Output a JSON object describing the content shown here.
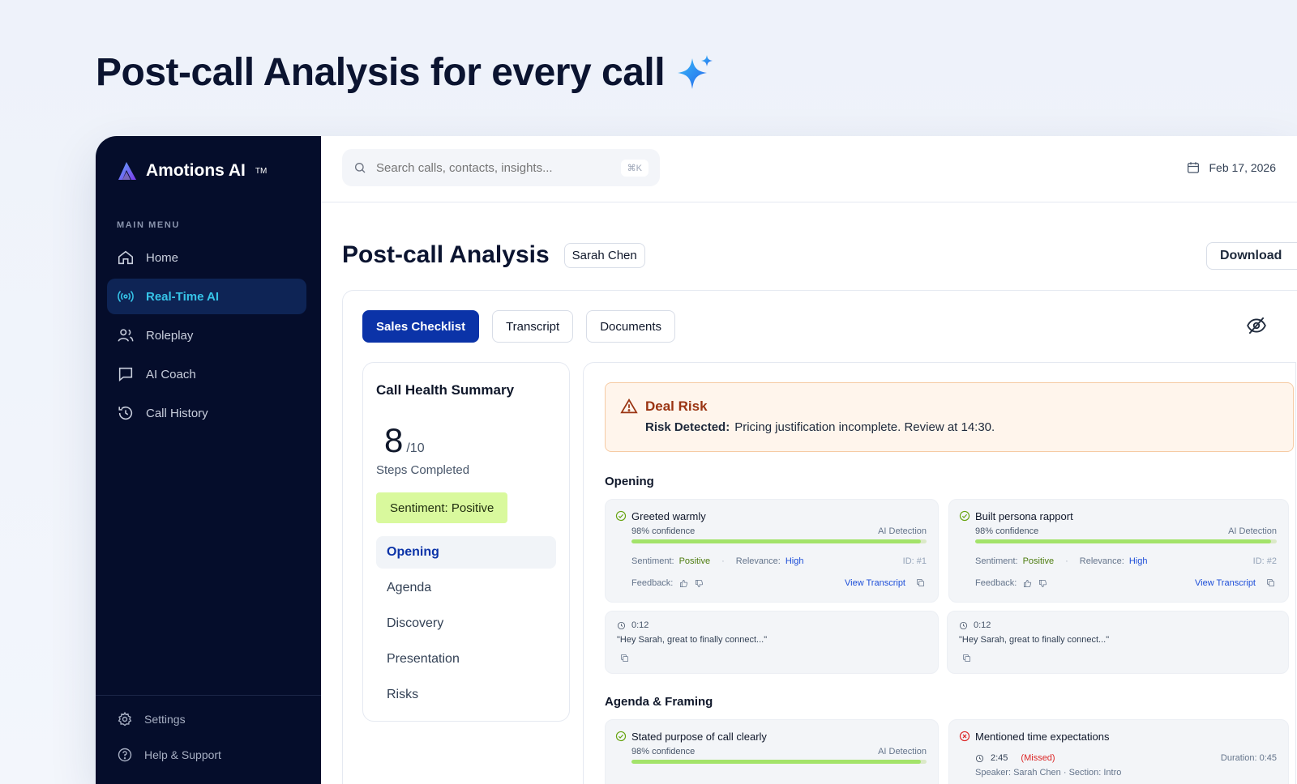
{
  "hero": {
    "title": "Post-call Analysis for every call"
  },
  "brand": {
    "name": "Amotions AI",
    "tm": "TM"
  },
  "sidebar": {
    "menu_label": "MAIN MENU",
    "items": [
      {
        "label": "Home",
        "icon": "home-icon"
      },
      {
        "label": "Real-Time AI",
        "icon": "broadcast-icon"
      },
      {
        "label": "Roleplay",
        "icon": "users-icon"
      },
      {
        "label": "AI Coach",
        "icon": "chat-icon"
      },
      {
        "label": "Call History",
        "icon": "history-icon"
      }
    ],
    "bottom": [
      {
        "label": "Settings",
        "icon": "gear-icon"
      },
      {
        "label": "Help & Support",
        "icon": "help-icon"
      }
    ]
  },
  "search": {
    "placeholder": "Search calls, contacts, insights...",
    "shortcut": "⌘K"
  },
  "topbar": {
    "date": "Feb 17, 2026"
  },
  "page": {
    "title": "Post-call Analysis",
    "person": "Sarah Chen",
    "download": "Download"
  },
  "tabs": [
    "Sales Checklist",
    "Transcript",
    "Documents"
  ],
  "summary": {
    "title": "Call Health Summary",
    "score": "8",
    "score_total": "/10",
    "steps_label": "Steps Completed",
    "sentiment": "Sentiment: Positive",
    "sections": [
      "Opening",
      "Agenda",
      "Discovery",
      "Presentation",
      "Risks"
    ]
  },
  "risk": {
    "title": "Deal Risk",
    "label": "Risk Detected:",
    "text": "Pricing justification incomplete. Review at 14:30."
  },
  "groups": {
    "opening": "Opening",
    "agenda": "Agenda & Framing"
  },
  "labels": {
    "confidence": "98% confidence",
    "ai_detection": "AI Detection",
    "sentiment": "Sentiment:",
    "positive": "Positive",
    "relevance": "Relevance:",
    "high": "High",
    "feedback": "Feedback:",
    "view_transcript": "View Transcript"
  },
  "cards": {
    "c1": {
      "title": "Greeted warmly",
      "id": "ID: #1",
      "progress": 0.98
    },
    "c2": {
      "title": "Built persona rapport",
      "id": "ID: #2",
      "progress": 0.98
    },
    "c3": {
      "title": "Stated purpose of call clearly",
      "progress": 0.98
    },
    "c4": {
      "title": "Mentioned time expectations",
      "time": "2:45",
      "status": "(Missed)",
      "duration": "Duration: 0:45",
      "speaker": "Speaker: Sarah Chen  ·  Section: Intro"
    }
  },
  "quotes": {
    "q1": {
      "time": "0:12",
      "text": "\"Hey Sarah, great to finally connect...\""
    },
    "q2": {
      "time": "0:12",
      "text": "\"Hey Sarah, great to finally connect...\""
    }
  },
  "colors": {
    "sidebar_bg": "#050d2b",
    "accent_cyan": "#36c4e8",
    "primary_blue": "#0b33a8",
    "positive_green": "#a3e36a",
    "risk_orange": "#9a3412",
    "missed_red": "#dc2626"
  }
}
